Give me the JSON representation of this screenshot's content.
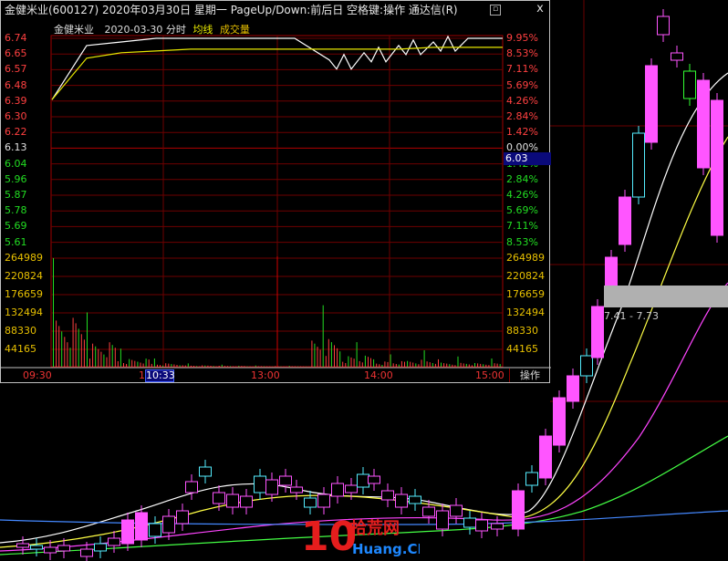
{
  "window": {
    "title": "金健米业(600127)  2020年03月30日  星期一  PageUp/Down:前后日  空格键:操作  通达信(R)",
    "close_glyph": "x"
  },
  "chart_header": {
    "stock_name": "金健米业",
    "date_time": "2020-03-30 分时",
    "avg_label": "均线",
    "vol_label": "成交量"
  },
  "colors": {
    "up": "#ff3c3c",
    "down": "#22dd22",
    "avg": "#e8e800",
    "grid": "#7a0000",
    "bull_candle": "#ff55ff",
    "bear_candle": "#55eeff"
  },
  "price_axis_left": [
    "6.74",
    "6.65",
    "6.57",
    "6.48",
    "6.39",
    "6.30",
    "6.22",
    "6.13",
    "6.04",
    "5.96",
    "5.87",
    "5.78",
    "5.69",
    "5.61"
  ],
  "pct_axis_right": [
    "9.95%",
    "8.53%",
    "7.11%",
    "5.69%",
    "4.26%",
    "2.84%",
    "1.42%",
    "0.00%",
    "1.42%",
    "2.84%",
    "4.26%",
    "5.69%",
    "7.11%",
    "8.53%"
  ],
  "volume_axis_left": [
    "264989",
    "220824",
    "176659",
    "132494",
    "88330",
    "44165"
  ],
  "volume_axis_right": [
    "264989",
    "220824",
    "176659",
    "132494",
    "88330",
    "44165"
  ],
  "time_axis": [
    "09:30",
    "1",
    "13:00",
    "14:00",
    "15:00"
  ],
  "cursor_time": "10:33",
  "cursor_price": "6.03",
  "operation_button": "操作",
  "range_label": "7.41 - 7.73",
  "watermark": {
    "digits": "10",
    "cn": "拾荒网",
    "en": "Huang.CN"
  },
  "chart_data": {
    "type": "line",
    "title": "金健米业 2020-03-30 分时",
    "prev_close": 6.13,
    "ylim": [
      5.61,
      6.74
    ],
    "x": [
      "09:30",
      "10:30",
      "11:30/13:00",
      "14:00",
      "15:00"
    ],
    "series": [
      {
        "name": "price",
        "values": [
          6.4,
          6.7,
          6.72,
          6.74,
          6.74,
          6.74,
          6.74,
          6.74,
          6.62,
          6.66,
          6.7,
          6.72,
          6.74,
          6.74
        ]
      },
      {
        "name": "均线",
        "values": [
          6.4,
          6.63,
          6.66,
          6.67,
          6.68,
          6.68,
          6.68,
          6.68,
          6.68,
          6.68,
          6.68,
          6.69,
          6.69,
          6.69
        ]
      }
    ],
    "volume": [
      264989,
      132494,
      44165,
      20000,
      8000,
      5000,
      3000,
      2000,
      150000,
      60000,
      30000,
      40000,
      25000,
      20000
    ],
    "volume_ylim": [
      0,
      264989
    ]
  }
}
